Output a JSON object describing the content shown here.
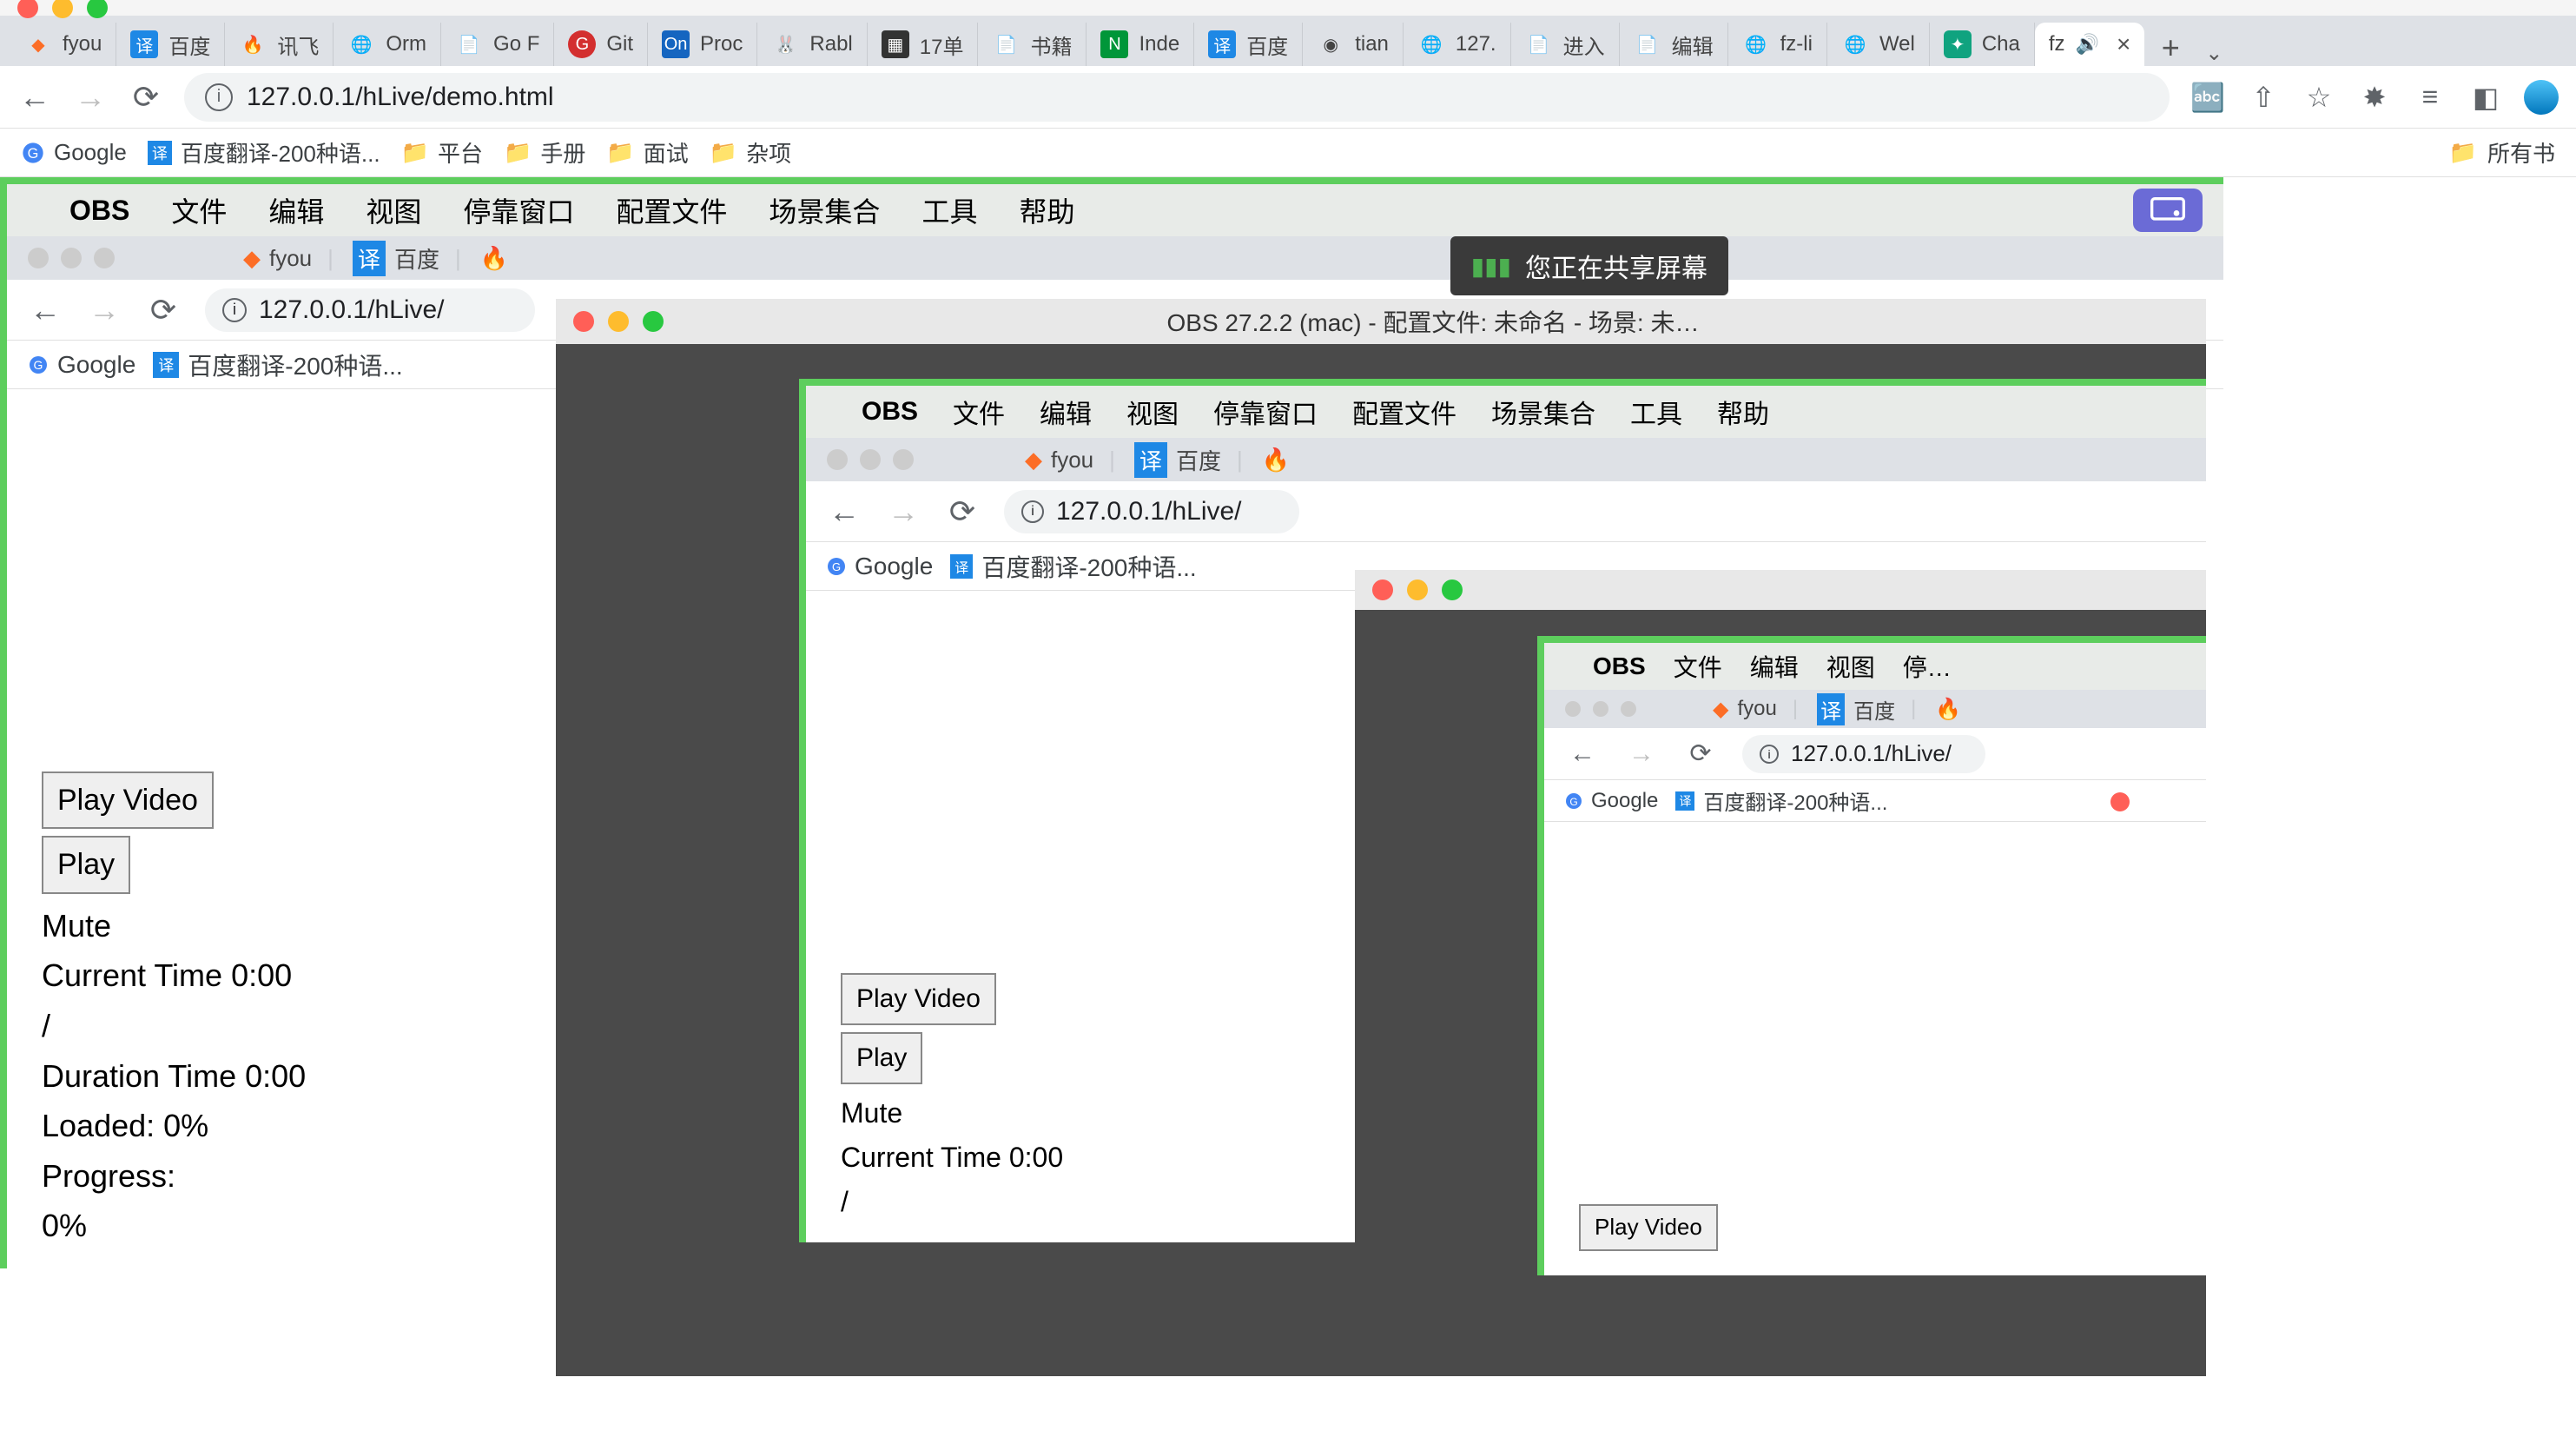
{
  "mac": {
    "traffic": [
      "red",
      "yellow",
      "green"
    ]
  },
  "tabs": [
    {
      "icon": "gitlab",
      "label": "fyou"
    },
    {
      "icon": "baidu",
      "label": "百度"
    },
    {
      "icon": "fire",
      "label": "讯飞"
    },
    {
      "icon": "globe",
      "label": "Orm"
    },
    {
      "icon": "note",
      "label": "Go F"
    },
    {
      "icon": "git",
      "label": "Git"
    },
    {
      "icon": "on",
      "label": "Proc"
    },
    {
      "icon": "rabbit",
      "label": "Rabl"
    },
    {
      "icon": "dark",
      "label": "17单"
    },
    {
      "icon": "note",
      "label": "书籍"
    },
    {
      "icon": "nginx",
      "label": "Inde"
    },
    {
      "icon": "baidu",
      "label": "百度"
    },
    {
      "icon": "globe2",
      "label": "tian"
    },
    {
      "icon": "globe",
      "label": "127."
    },
    {
      "icon": "note",
      "label": "进入"
    },
    {
      "icon": "note",
      "label": "编辑"
    },
    {
      "icon": "globe",
      "label": "fz-li"
    },
    {
      "icon": "globe",
      "label": "Wel"
    },
    {
      "icon": "chat",
      "label": "Cha"
    },
    {
      "icon": "blank",
      "label": "fz",
      "active": true,
      "audio": true
    }
  ],
  "url": "127.0.0.1/hLive/demo.html",
  "bookmarks": [
    {
      "icon": "google",
      "label": "Google"
    },
    {
      "icon": "baidu",
      "label": "百度翻译-200种语..."
    },
    {
      "icon": "folder",
      "label": "平台"
    },
    {
      "icon": "folder",
      "label": "手册"
    },
    {
      "icon": "folder",
      "label": "面试"
    },
    {
      "icon": "folder",
      "label": "杂项"
    }
  ],
  "bm_right": {
    "icon": "folder",
    "label": "所有书"
  },
  "obs_menu": [
    "文件",
    "编辑",
    "视图",
    "停靠窗口",
    "配置文件",
    "场景集合",
    "工具",
    "帮助"
  ],
  "obs_app": "OBS",
  "share_text": "您正在共享屏幕",
  "obs_title": "OBS 27.2.2 (mac) - 配置文件: 未命名 - 场景: 未…",
  "inner_tabs": [
    {
      "icon": "gitlab",
      "label": "fyou"
    },
    {
      "icon": "baidu",
      "label": "百度"
    },
    {
      "icon": "fire",
      "label": ""
    }
  ],
  "inner_url": "127.0.0.1/hLive/",
  "inner_bm": [
    {
      "icon": "google",
      "label": "Google"
    },
    {
      "icon": "baidu",
      "label": "百度翻译-200种语..."
    }
  ],
  "video": {
    "play_video": "Play Video",
    "play": "Play",
    "mute": "Mute",
    "current_label": "Current Time",
    "current_val": "0:00",
    "slash": "/",
    "duration_label": "Duration Time",
    "duration_val": "0:00",
    "loaded_label": "Loaded:",
    "loaded_val": "0%",
    "progress_label": "Progress:",
    "progress_val": "0%"
  }
}
